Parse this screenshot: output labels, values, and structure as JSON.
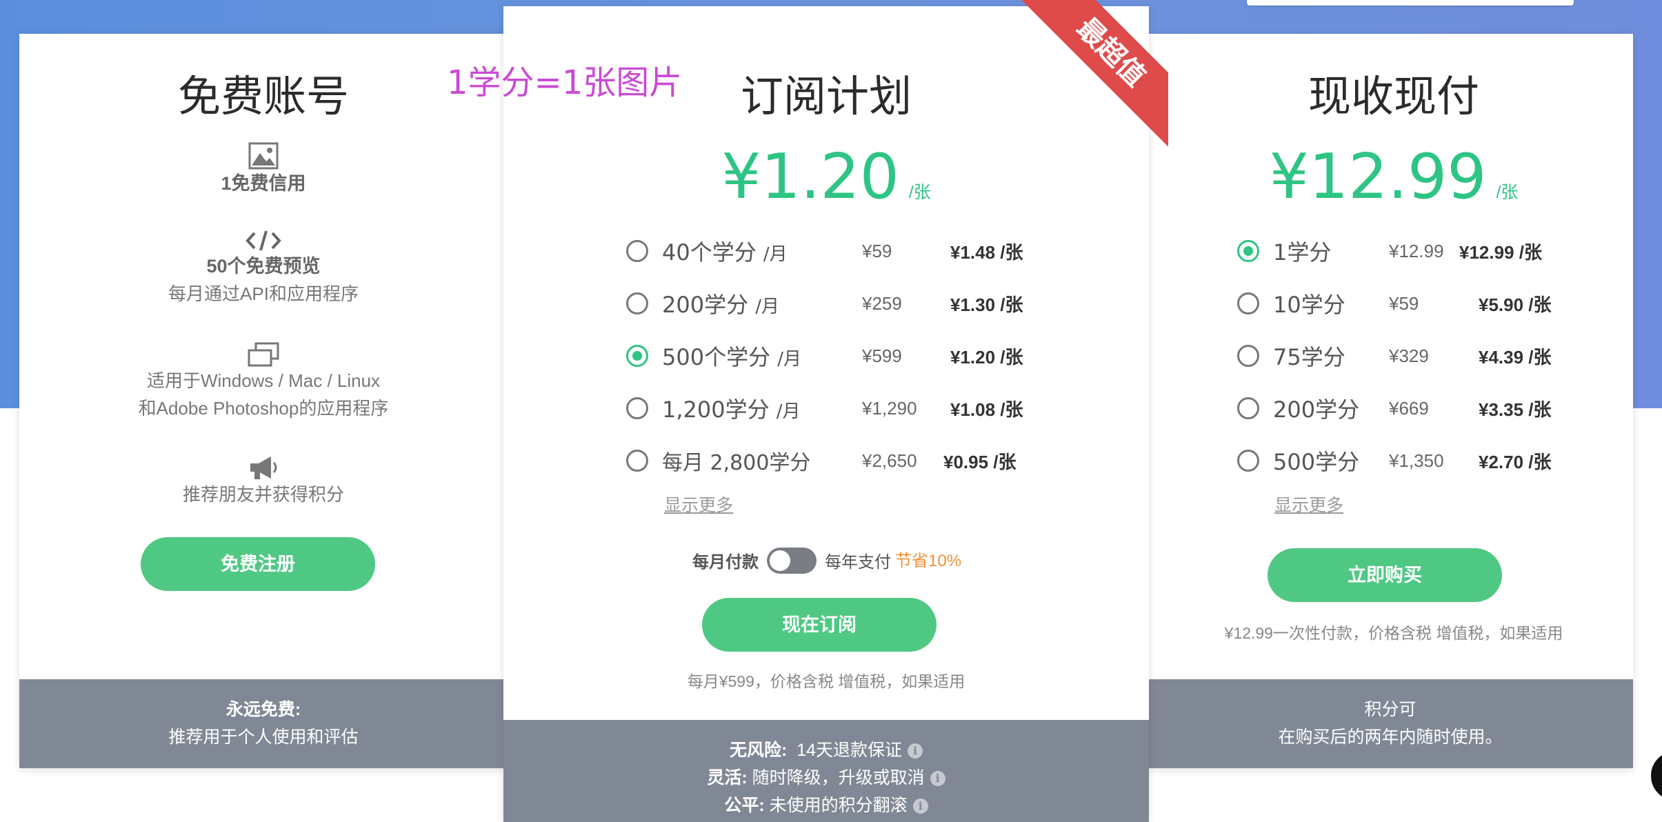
{
  "overlay_text": "1学分=1张图片",
  "free": {
    "title": "免费账号",
    "f1": "1免费信用",
    "f2_bold": "50个免费预览",
    "f2_sub": "每月通过API和应用程序",
    "f3_l1": "适用于Windows / Mac / Linux",
    "f3_l2": "和Adobe Photoshop的应用程序",
    "f4": "推荐朋友并获得积分",
    "button": "免费注册",
    "foot_bold": "永远免费:",
    "foot_text": "推荐用于个人使用和评估"
  },
  "sub": {
    "title": "订阅计划",
    "ribbon": "最超值",
    "price": "¥1.20",
    "price_unit": "/张",
    "plans": [
      {
        "name": "40个学分 ",
        "per": "/月",
        "price": "¥59",
        "unit": "¥1.48 /张",
        "selected": false
      },
      {
        "name": "200学分 ",
        "per": "/月",
        "price": "¥259",
        "unit": "¥1.30 /张",
        "selected": false
      },
      {
        "name": "500个学分 ",
        "per": "/月",
        "price": "¥599",
        "unit": "¥1.20 /张",
        "selected": true
      },
      {
        "name": "1,200学分 ",
        "per": "/月",
        "price": "¥1,290",
        "unit": "¥1.08 /张",
        "selected": false
      },
      {
        "name": "每月 2,800学分",
        "per": "",
        "price": "¥2,650",
        "unit": "¥0.95 /张",
        "selected": false
      }
    ],
    "show_more": "显示更多",
    "toggle_left": "每月付款",
    "toggle_right": "每年支付",
    "toggle_save": "节省10%",
    "toggle_on": false,
    "button": "现在订阅",
    "note": "每月¥599，价格含税 增值税，如果适用",
    "foot": [
      {
        "bold": "无风险:",
        "text": "14天退款保证"
      },
      {
        "bold": "灵活:",
        "text": "随时降级，升级或取消"
      },
      {
        "bold": "公平:",
        "text": "未使用的积分翻滚"
      }
    ]
  },
  "payg": {
    "title": "现收现付",
    "price": "¥12.99",
    "price_unit": "/张",
    "plans": [
      {
        "name": "1学分",
        "price": "¥12.99",
        "unit": "¥12.99 /张",
        "selected": true
      },
      {
        "name": "10学分",
        "price": "¥59",
        "unit": "¥5.90 /张",
        "selected": false
      },
      {
        "name": "75学分",
        "price": "¥329",
        "unit": "¥4.39 /张",
        "selected": false
      },
      {
        "name": "200学分",
        "price": "¥669",
        "unit": "¥3.35 /张",
        "selected": false
      },
      {
        "name": "500学分",
        "price": "¥1,350",
        "unit": "¥2.70 /张",
        "selected": false
      }
    ],
    "show_more": "显示更多",
    "button": "立即购买",
    "note": "¥12.99一次性付款，价格含税 增值税，如果适用",
    "foot_l1": "积分可",
    "foot_l2": "在购买后的两年内随时使用。"
  },
  "icons": [
    "image-icon",
    "code-icon",
    "windows-icon",
    "megaphone-icon",
    "info-icon"
  ],
  "colors": {
    "accent": "#4fc884",
    "price": "#2ec483",
    "ribbon": "#df4a4a",
    "footer": "#818895",
    "overlay": "#c94bd4",
    "save": "#f0903a"
  }
}
